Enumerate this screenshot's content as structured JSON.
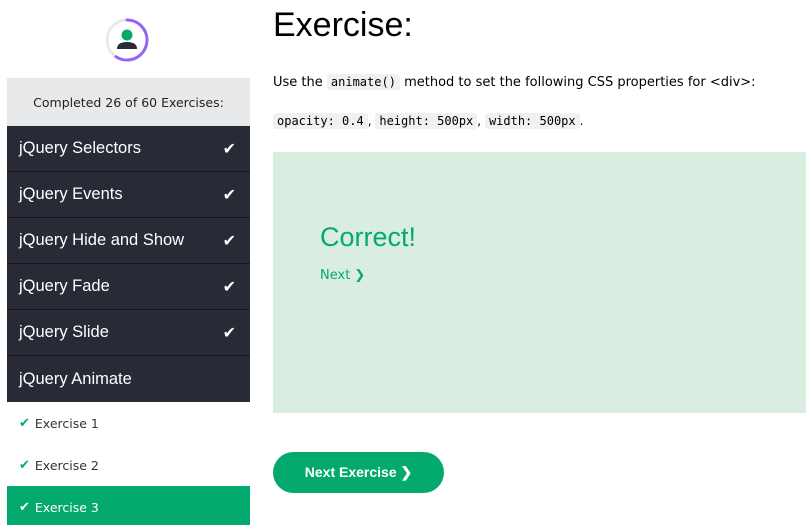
{
  "colors": {
    "accent": "#04aa6d",
    "dark": "#282a35",
    "success_bg": "#d9eee1",
    "ring": "#9763f6",
    "grey": "#e7e9eb"
  },
  "sidebar": {
    "avatar_icon": "user-icon",
    "progress_text": "Completed 26 of 60 Exercises:",
    "topics": [
      {
        "label": "jQuery Selectors",
        "completed": true
      },
      {
        "label": "jQuery Events",
        "completed": true
      },
      {
        "label": "jQuery Hide and Show",
        "completed": true
      },
      {
        "label": "jQuery Fade",
        "completed": true
      },
      {
        "label": "jQuery Slide",
        "completed": true
      },
      {
        "label": "jQuery Animate",
        "completed": false
      }
    ],
    "exercises": [
      {
        "label": "Exercise 1",
        "completed": true,
        "active": false
      },
      {
        "label": "Exercise 2",
        "completed": true,
        "active": false
      },
      {
        "label": "Exercise 3",
        "completed": true,
        "active": true
      }
    ],
    "check_icon": "✔"
  },
  "main": {
    "title": "Exercise:",
    "instruction_prefix": "Use the",
    "instruction_code": "animate()",
    "instruction_suffix": "method to set the following CSS properties for <div>:",
    "props": [
      "opacity: 0.4",
      "height: 500px",
      "width: 500px"
    ],
    "prop_sep": ",",
    "prop_end": ".",
    "result": "Correct!",
    "next_link": "Next ❯",
    "next_button": "Next Exercise ❯"
  }
}
